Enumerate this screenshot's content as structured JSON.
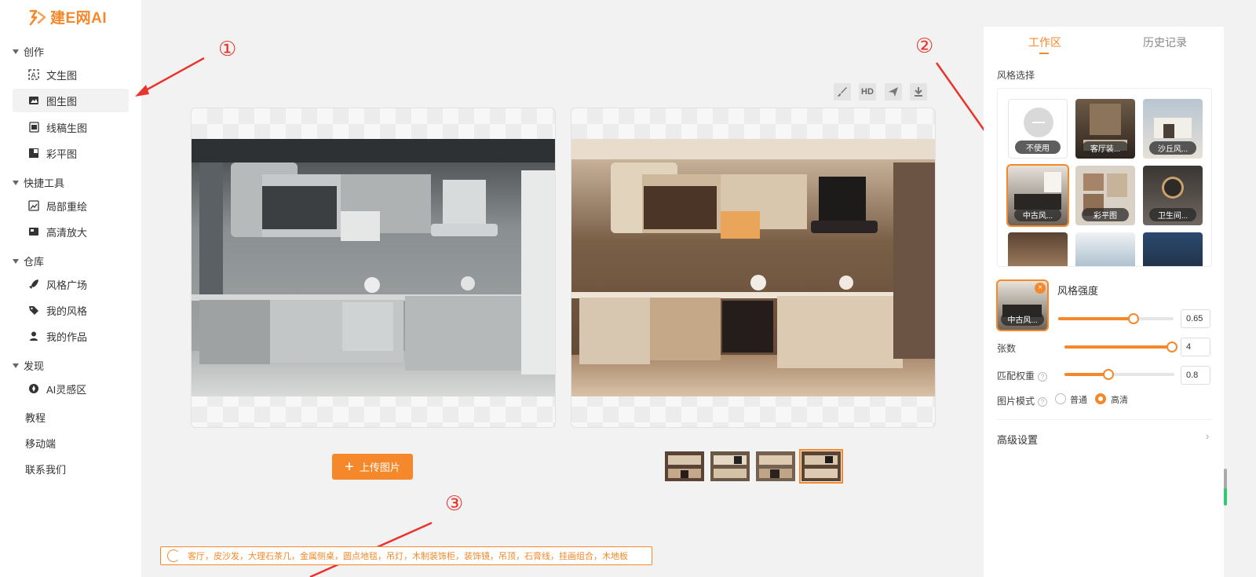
{
  "app": {
    "logo_text": "建E网AI"
  },
  "sidebar": {
    "sections": [
      {
        "label": "创作"
      },
      {
        "label": "快捷工具"
      },
      {
        "label": "仓库"
      },
      {
        "label": "发现"
      }
    ],
    "items": [
      {
        "label": "文生图"
      },
      {
        "label": "图生图"
      },
      {
        "label": "线稿生图"
      },
      {
        "label": "彩平图"
      },
      {
        "label": "局部重绘"
      },
      {
        "label": "高清放大"
      },
      {
        "label": "风格广场"
      },
      {
        "label": "我的风格"
      },
      {
        "label": "我的作品"
      },
      {
        "label": "AI灵感区"
      }
    ],
    "links": [
      {
        "label": "教程"
      },
      {
        "label": "移动端"
      },
      {
        "label": "联系我们"
      }
    ],
    "active_item": "图生图"
  },
  "toolbar": {
    "hd_label": "HD"
  },
  "main": {
    "upload_label": "上传图片",
    "prompt_text": "客厅，皮沙发，大理石茶几，金属侧桌，圆点地毯，吊灯，木制装饰柜，装饰镜，吊顶，石膏线，挂画组合，木地板",
    "selected_thumb": 4
  },
  "annotations": {
    "a1": "①",
    "a2": "②",
    "a3": "③"
  },
  "right_panel": {
    "tabs": [
      {
        "label": "工作区"
      },
      {
        "label": "历史记录"
      }
    ],
    "active_tab": "工作区",
    "style_select_label": "风格选择",
    "styles": [
      {
        "label": "不使用"
      },
      {
        "label": "客厅装..."
      },
      {
        "label": "沙丘风..."
      },
      {
        "label": "中古风..."
      },
      {
        "label": "彩平图"
      },
      {
        "label": "卫生间..."
      }
    ],
    "selected_style": "中古风...",
    "current_style_label": "中古风...",
    "strength": {
      "label": "风格强度",
      "value": "0.65",
      "fraction": 0.65
    },
    "count": {
      "label": "张数",
      "value": "4",
      "fraction": 1.0
    },
    "weight": {
      "label": "匹配权重",
      "value": "0.8",
      "fraction": 0.4
    },
    "mode": {
      "label": "图片模式",
      "options": [
        "普通",
        "高清"
      ],
      "selected": "高清"
    },
    "advanced_label": "高级设置"
  },
  "colors": {
    "accent": "#f5882a",
    "annotation": "#e8342b"
  }
}
